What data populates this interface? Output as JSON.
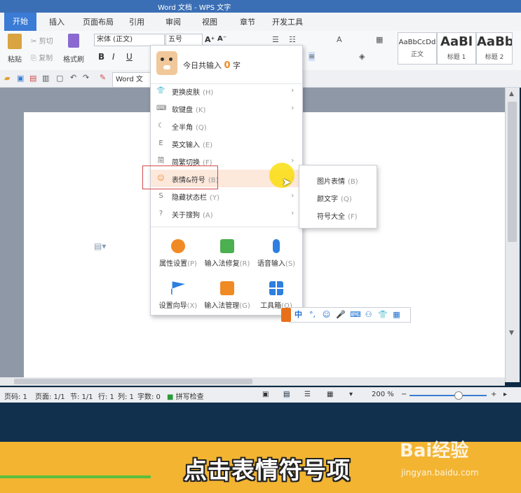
{
  "titlebar": {
    "text": "Word 文档 - WPS 文字"
  },
  "tabs": [
    "开始",
    "插入",
    "页面布局",
    "引用",
    "审阅",
    "视图",
    "章节",
    "开发工具"
  ],
  "ribbon": {
    "paste": "粘贴",
    "cut": "剪切",
    "copy": "复制",
    "format_painter": "格式刷",
    "font_name": "宋体 (正文)",
    "font_size": "五号",
    "styles": [
      {
        "preview": "AaBbCcDd",
        "name": "正文"
      },
      {
        "preview": "AaBl",
        "name": "标题 1"
      },
      {
        "preview": "AaBb",
        "name": "标题 2"
      }
    ]
  },
  "doc_tab": "Word 文",
  "sogou_menu": {
    "header_prefix": "今日共输入",
    "header_count": "0",
    "header_suffix": "字",
    "items": [
      {
        "label": "更换皮肤",
        "key": "(H)",
        "icon": "shirt-icon"
      },
      {
        "label": "软键盘",
        "key": "(K)",
        "icon": "keyboard-icon"
      },
      {
        "label": "全半角",
        "key": "(Q)",
        "icon": "moon-icon"
      },
      {
        "label": "英文输入",
        "key": "(E)",
        "icon": "english-icon"
      },
      {
        "label": "简繁切换",
        "key": "(F)",
        "icon": "simplified-icon"
      },
      {
        "label": "表情&符号",
        "key": "(B)",
        "icon": "smile-icon"
      },
      {
        "label": "隐藏状态栏",
        "key": "(Y)",
        "icon": "hide-icon"
      },
      {
        "label": "关于搜狗",
        "key": "(A)",
        "icon": "question-icon"
      }
    ],
    "grid": [
      {
        "label": "属性设置",
        "key": "(P)",
        "icon": "gear-icon",
        "color": "#f08a24"
      },
      {
        "label": "输入法修复",
        "key": "(R)",
        "icon": "repair-icon",
        "color": "#4caf50"
      },
      {
        "label": "语音输入",
        "key": "(S)",
        "icon": "microphone-icon",
        "color": "#2d7fe0"
      },
      {
        "label": "设置向导",
        "key": "(X)",
        "icon": "flag-icon",
        "color": "#2d7fe0"
      },
      {
        "label": "输入法管理",
        "key": "(G)",
        "icon": "list-icon",
        "color": "#f08a24"
      },
      {
        "label": "工具箱",
        "key": "(O)",
        "icon": "toolbox-icon",
        "color": "#2d7fe0"
      }
    ]
  },
  "submenu": [
    {
      "label": "图片表情",
      "key": "(B)"
    },
    {
      "label": "颜文字",
      "key": "(Q)"
    },
    {
      "label": "符号大全",
      "key": "(F)"
    }
  ],
  "ime_bar": {
    "mode": "中"
  },
  "statusbar": {
    "page_code": "页码: 1",
    "pages": "页面: 1/1",
    "section": "节: 1/1",
    "row": "行: 1",
    "col": "列: 1",
    "words": "字数: 0",
    "spell": "拼写检查",
    "zoom": "200 %"
  },
  "caption": "点击表情符号项",
  "watermark": {
    "brand": "Bai经验",
    "url": "jingyan.baidu.com"
  }
}
